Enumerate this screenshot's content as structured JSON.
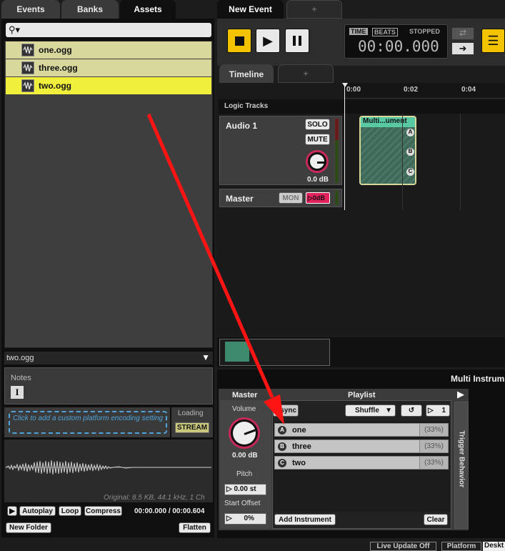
{
  "left_tabs": [
    "Events",
    "Banks",
    "Assets"
  ],
  "assets": [
    {
      "name": "one.ogg",
      "selected": false
    },
    {
      "name": "three.ogg",
      "selected": false
    },
    {
      "name": "two.ogg",
      "selected": true
    }
  ],
  "search": {
    "placeholder": ""
  },
  "asset_detail": {
    "name": "two.ogg",
    "notes_label": "Notes",
    "platform_hint": "Click to add a custom platform encoding setting",
    "loading_label": "Loading",
    "stream_label": "STREAM",
    "info": "Original: 8.5 KB, 44.1 kHz, 1 Ch",
    "autoplay": "Autoplay",
    "loop": "Loop",
    "compress": "Compress",
    "time": "00:00.000 / 00:00.604",
    "new_folder": "New Folder",
    "flatten": "Flatten"
  },
  "editor_tabs": {
    "active": "New Event",
    "add": "+"
  },
  "transport": {
    "time_label": "TIME",
    "beats_label": "BEATS",
    "state": "STOPPED",
    "time": "00:00.000"
  },
  "timeline": {
    "tab": "Timeline",
    "add": "+",
    "ruler": [
      "0:00",
      "0:02",
      "0:04"
    ],
    "logic_tracks": "Logic Tracks",
    "track_name": "Audio 1",
    "solo": "SOLO",
    "mute": "MUTE",
    "track_db": "0.0 dB",
    "master_name": "Master",
    "mon": "MON",
    "master_value": "0dB",
    "instrument_title": "Multi...ument",
    "instrument_slots": [
      "A",
      "B",
      "C"
    ]
  },
  "deck": {
    "header": "Multi Instrum",
    "master_label": "Master",
    "volume_label": "Volume",
    "volume_value": "0.00 dB",
    "pitch_label": "Pitch",
    "pitch_value": "0.00 st",
    "start_offset_label": "Start Offset",
    "start_offset_value": "0%",
    "playlist_label": "Playlist",
    "async": "Async",
    "shuffle": "Shuffle",
    "count": "1",
    "items": [
      {
        "letter": "A",
        "name": "one",
        "pct": "(33%)"
      },
      {
        "letter": "B",
        "name": "three",
        "pct": "(33%)"
      },
      {
        "letter": "C",
        "name": "two",
        "pct": "(33%)"
      }
    ],
    "add_instrument": "Add Instrument",
    "clear": "Clear",
    "trigger_behavior": "Trigger Behavior"
  },
  "status_bar": {
    "live_update": "Live Update Off",
    "platform": "Platform",
    "desktop": "Deskt"
  },
  "colors": {
    "accent_yellow": "#f4c300",
    "selected_row": "#f0ef3c",
    "row": "#d8d89c",
    "instrument_green": "#58c9a3",
    "knob_red": "#c72a5a",
    "arrow_red": "#ff1414"
  }
}
